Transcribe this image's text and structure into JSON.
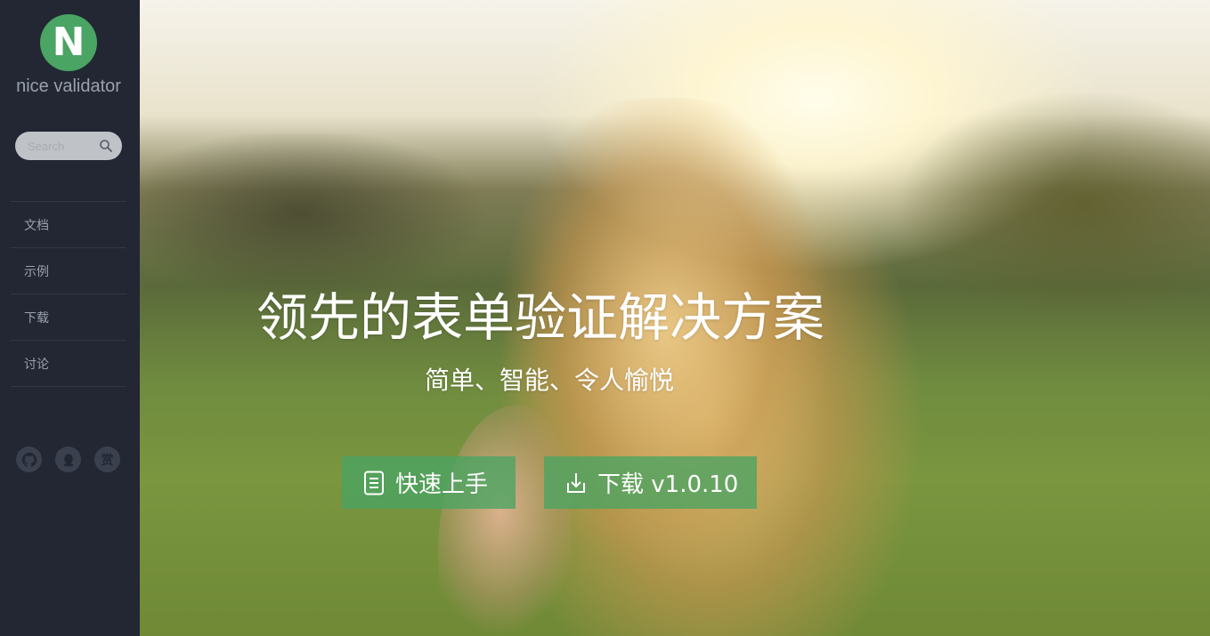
{
  "brand": {
    "logo_letter": "N",
    "name": "nice validator",
    "accent_color": "#4aa463"
  },
  "search": {
    "placeholder": "Search"
  },
  "nav": {
    "items": [
      {
        "label": "文档"
      },
      {
        "label": "示例"
      },
      {
        "label": "下载"
      },
      {
        "label": "讨论"
      }
    ]
  },
  "social": {
    "icons": [
      "github-icon",
      "qq-icon",
      "reward-icon"
    ],
    "reward_label": "赏"
  },
  "hero": {
    "headline": "领先的表单验证解决方案",
    "subtitle": "简单、智能、令人愉悦",
    "buttons": {
      "quick_start": "快速上手",
      "download": "下载 v1.0.10"
    }
  }
}
